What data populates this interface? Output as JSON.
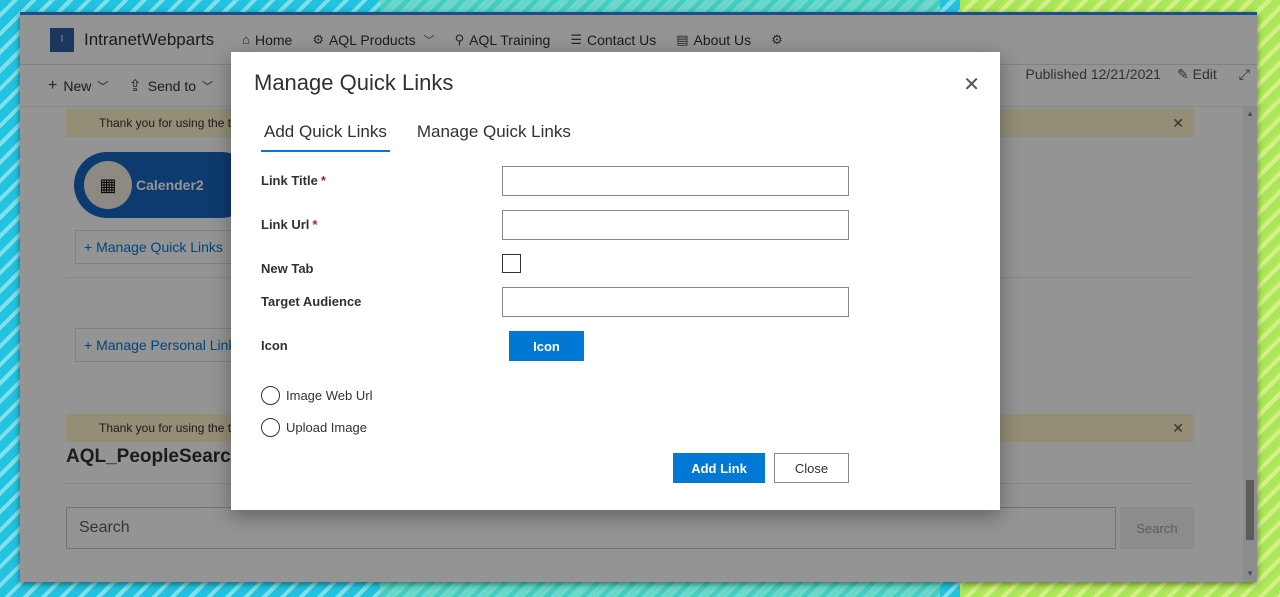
{
  "site": {
    "logo_text": "I",
    "title": "IntranetWebparts",
    "nav": [
      {
        "label": "Home",
        "icon": "home-icon"
      },
      {
        "label": "AQL Products",
        "icon": "products-icon",
        "has_dropdown": true
      },
      {
        "label": "AQL Training",
        "icon": "training-icon"
      },
      {
        "label": "Contact Us",
        "icon": "contact-icon"
      },
      {
        "label": "About Us",
        "icon": "about-icon"
      }
    ]
  },
  "commandbar": {
    "new_label": "New",
    "send_label": "Send to",
    "published": "Published 12/21/2021",
    "edit_label": "Edit"
  },
  "page": {
    "banner_text": "Thank you for using the tri",
    "quick_link": {
      "label": "Calender2"
    },
    "manage_quick_links": "Manage Quick Links",
    "manage_personal_links": "Manage Personal Links",
    "section_title": "AQL_PeopleSearch",
    "search_placeholder": "Search",
    "search_button": "Search"
  },
  "dialog": {
    "title": "Manage Quick Links",
    "tabs": [
      {
        "label": "Add Quick Links",
        "active": true
      },
      {
        "label": "Manage Quick Links",
        "active": false
      }
    ],
    "fields": {
      "link_title": "Link Title",
      "link_url": "Link Url",
      "new_tab": "New Tab",
      "target_audience": "Target Audience",
      "icon": "Icon"
    },
    "required_marker": "*",
    "icon_button": "Icon",
    "radio_options": [
      "Image Web Url",
      "Upload Image"
    ],
    "add_button": "Add Link",
    "close_button": "Close"
  },
  "colors": {
    "accent": "#0078d4",
    "brand": "#1967c0",
    "banner": "#fff4ce"
  }
}
